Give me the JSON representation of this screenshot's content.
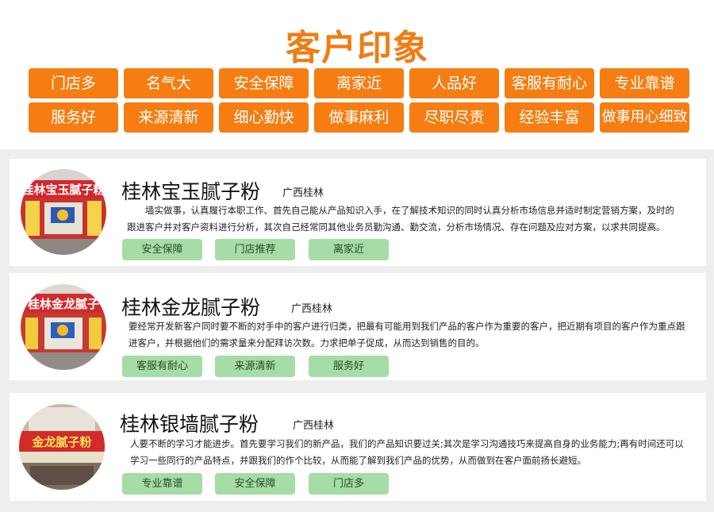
{
  "header": {
    "title": "客户印象",
    "tags_row1": [
      "门店多",
      "名气大",
      "安全保障",
      "离家近",
      "人品好",
      "客服有耐心",
      "专业靠谱"
    ],
    "tags_row2": [
      "服务好",
      "来源清新",
      "细心勤快",
      "做事麻利",
      "尽职尽责",
      "经验丰富",
      "做事用心细致"
    ]
  },
  "cards": [
    {
      "title": "桂林宝玉腻子粉",
      "region": "广西桂林",
      "desc_line1": "　　墙实做事，认真履行本职工作、首先自己能从产品知识入手，在了解技术知识的同时认真分析市场信息并适时制定营销方案，及时的",
      "desc_line2": "跟进客户并对客户资料进行分析，其次自己经常同其他业务员勤沟通、勤交流，分析市场情况、存在问题及应对方案，以求共同提高。",
      "pills": [
        "安全保障",
        "门店推荐",
        "离家近"
      ],
      "avatar_sign": "桂林宝玉腻子粉"
    },
    {
      "title": "桂林金龙腻子粉",
      "region": "广西桂林",
      "desc_line1": "要经常开发新客户同时要不断的对手中的客户进行归类，把最有可能用到我们产品的客户作为重要的客户，把近期有项目的客户作为重点跟",
      "desc_line2": "进客户，并根据他们的需求量来分配拜访次数。力求把单子促成，从而达到销售的目的。",
      "pills": [
        "客服有耐心",
        "来源清新",
        "服务好"
      ],
      "avatar_sign": "桂林金龙腻子"
    },
    {
      "title": "桂林银墙腻子粉",
      "region": "广西桂林",
      "desc_line1": "人要不断的学习才能进步。首先要学习我们的新产品，我们的产品知识要过关;其次是学习沟通技巧来提高自身的业务能力;再有时间还可以",
      "desc_line2": "学习一些同行的产品特点，并跟我们的作个比较，从而能了解到我们产品的优势，从而做到在客户面前扬长避短。",
      "pills": [
        "专业靠谱",
        "安全保障",
        "门店多"
      ],
      "avatar_sign": "金龙腻子粉"
    }
  ]
}
